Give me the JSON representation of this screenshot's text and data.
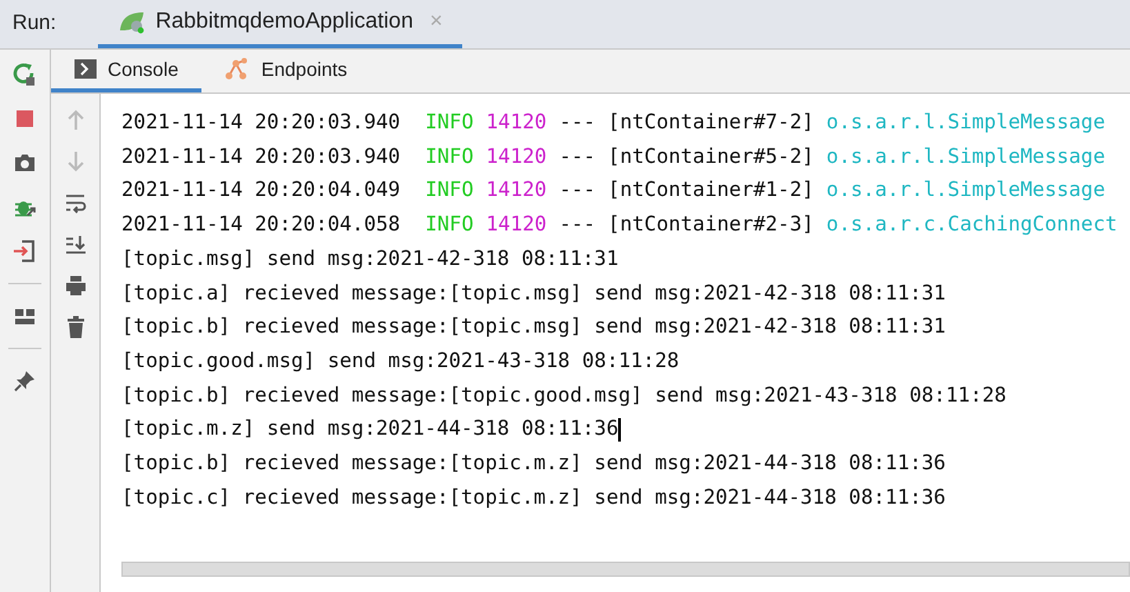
{
  "run_bar": {
    "label": "Run:",
    "tabs": [
      {
        "title": "RabbitmqdemoApplication",
        "close": "×",
        "selected": true
      }
    ]
  },
  "console_tabs": [
    {
      "label": "Console",
      "kind": "console",
      "selected": true
    },
    {
      "label": "Endpoints",
      "kind": "endpoints",
      "selected": false
    }
  ],
  "log_lines": [
    {
      "kind": "log",
      "timestamp": "2021-11-14 20:20:03.940",
      "level": "INFO",
      "pid": "14120",
      "separator": "---",
      "thread": "[ntContainer#7-2]",
      "logger": "o.s.a.r.l.SimpleMessage"
    },
    {
      "kind": "log",
      "timestamp": "2021-11-14 20:20:03.940",
      "level": "INFO",
      "pid": "14120",
      "separator": "---",
      "thread": "[ntContainer#5-2]",
      "logger": "o.s.a.r.l.SimpleMessage"
    },
    {
      "kind": "log",
      "timestamp": "2021-11-14 20:20:04.049",
      "level": "INFO",
      "pid": "14120",
      "separator": "---",
      "thread": "[ntContainer#1-2]",
      "logger": "o.s.a.r.l.SimpleMessage"
    },
    {
      "kind": "log",
      "timestamp": "2021-11-14 20:20:04.058",
      "level": "INFO",
      "pid": "14120",
      "separator": "---",
      "thread": "[ntContainer#2-3]",
      "logger": "o.s.a.r.c.CachingConnect"
    },
    {
      "kind": "plain",
      "text": "[topic.msg] send msg:2021-42-318 08:11:31",
      "cursor": false
    },
    {
      "kind": "plain",
      "text": "[topic.a] recieved message:[topic.msg] send msg:2021-42-318 08:11:31",
      "cursor": false
    },
    {
      "kind": "plain",
      "text": "[topic.b] recieved message:[topic.msg] send msg:2021-42-318 08:11:31",
      "cursor": false
    },
    {
      "kind": "plain",
      "text": "[topic.good.msg] send msg:2021-43-318 08:11:28",
      "cursor": false
    },
    {
      "kind": "plain",
      "text": "[topic.b] recieved message:[topic.good.msg] send msg:2021-43-318 08:11:28",
      "cursor": false
    },
    {
      "kind": "plain",
      "text": "[topic.m.z] send msg:2021-44-318 08:11:36",
      "cursor": true
    },
    {
      "kind": "plain",
      "text": "[topic.b] recieved message:[topic.m.z] send msg:2021-44-318 08:11:36",
      "cursor": false
    },
    {
      "kind": "plain",
      "text": "[topic.c] recieved message:[topic.m.z] send msg:2021-44-318 08:11:36",
      "cursor": false
    }
  ]
}
